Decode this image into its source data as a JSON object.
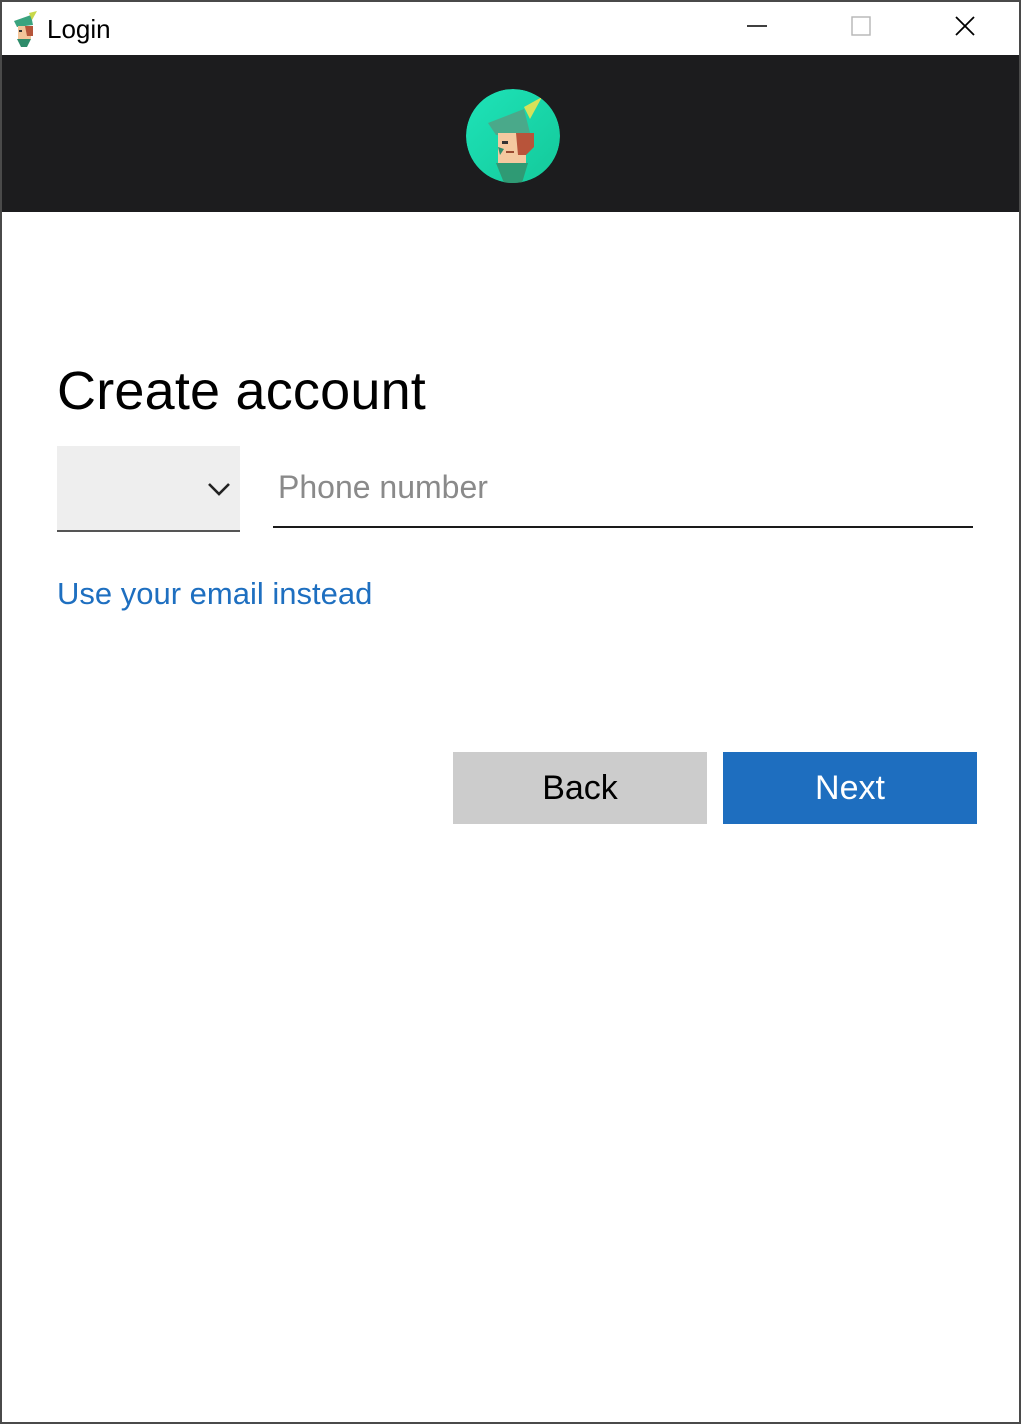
{
  "window": {
    "title": "Login",
    "controls": {
      "minimize": "minimize-icon",
      "maximize": "maximize-icon",
      "close": "close-icon"
    }
  },
  "header": {
    "avatar_icon": "robin-hood-avatar-icon",
    "background": "#1c1c1e",
    "avatar_color": "#1ed6ae"
  },
  "form": {
    "heading": "Create account",
    "country_select": {
      "value": "",
      "icon": "chevron-down-icon"
    },
    "phone": {
      "placeholder": "Phone number",
      "value": ""
    },
    "email_link": "Use your email instead"
  },
  "buttons": {
    "back": "Back",
    "next": "Next"
  },
  "colors": {
    "accent": "#1e6ebf",
    "link": "#1e6fc0",
    "secondary_button": "#cccccc"
  }
}
